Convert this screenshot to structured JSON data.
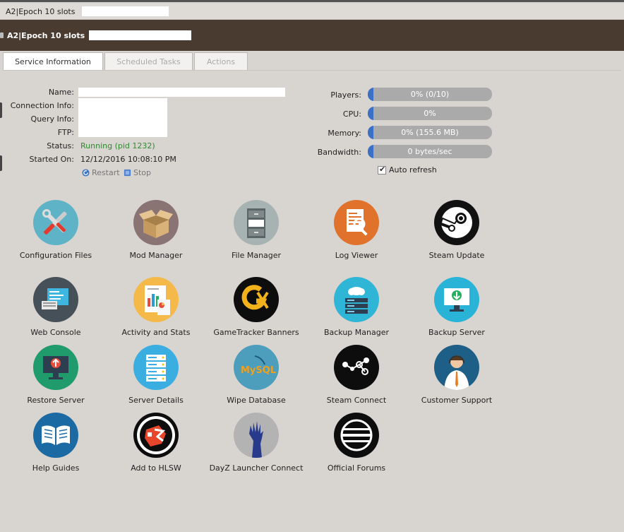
{
  "window": {
    "title": "A2|Epoch 10 slots"
  },
  "header": {
    "title": "A2|Epoch 10 slots"
  },
  "tabs": [
    {
      "label": "Service Information",
      "active": true
    },
    {
      "label": "Scheduled Tasks",
      "active": false
    },
    {
      "label": "Actions",
      "active": false
    }
  ],
  "service": {
    "name_label": "Name:",
    "connection_label": "Connection Info:",
    "query_label": "Query Info:",
    "ftp_label": "FTP:",
    "status_label": "Status:",
    "status_value": "Running (pid 1232)",
    "started_label": "Started On:",
    "started_value": "12/12/2016 10:08:10 PM",
    "restart_label": "Restart",
    "stop_label": "Stop"
  },
  "metrics": {
    "players": {
      "label": "Players:",
      "text": "0% (0/10)",
      "percent": 0
    },
    "cpu": {
      "label": "CPU:",
      "text": "0%",
      "percent": 0
    },
    "memory": {
      "label": "Memory:",
      "text": "0% (155.6 MB)",
      "percent": 0
    },
    "bandwidth": {
      "label": "Bandwidth:",
      "text": "0 bytes/sec",
      "percent": 0
    },
    "auto_refresh_label": "Auto refresh",
    "auto_refresh_checked": true
  },
  "tools": [
    {
      "label": "Configuration Files",
      "icon": "wrench-screwdriver-icon"
    },
    {
      "label": "Mod Manager",
      "icon": "open-box-icon"
    },
    {
      "label": "File Manager",
      "icon": "file-cabinet-icon"
    },
    {
      "label": "Log Viewer",
      "icon": "document-magnifier-icon"
    },
    {
      "label": "Steam Update",
      "icon": "steam-icon"
    },
    {
      "label": "Web Console",
      "icon": "console-icon"
    },
    {
      "label": "Activity and Stats",
      "icon": "stats-report-icon"
    },
    {
      "label": "GameTracker Banners",
      "icon": "gametracker-icon"
    },
    {
      "label": "Backup Manager",
      "icon": "cloud-server-icon"
    },
    {
      "label": "Backup Server",
      "icon": "monitor-download-icon"
    },
    {
      "label": "Restore Server",
      "icon": "monitor-upload-icon"
    },
    {
      "label": "Server Details",
      "icon": "server-rack-icon"
    },
    {
      "label": "Wipe Database",
      "icon": "mysql-icon"
    },
    {
      "label": "Steam Connect",
      "icon": "network-nodes-icon"
    },
    {
      "label": "Customer Support",
      "icon": "support-agent-icon"
    },
    {
      "label": "Help Guides",
      "icon": "open-book-icon"
    },
    {
      "label": "Add to HLSW",
      "icon": "hlsw-icon"
    },
    {
      "label": "DayZ Launcher Connect",
      "icon": "zombie-hand-icon"
    },
    {
      "label": "Official Forums",
      "icon": "forums-logo-icon"
    }
  ],
  "logos": {
    "mysql_text": "MySQL"
  },
  "colors": {
    "header_bg": "#4a3b30",
    "page_bg": "#d8d4d0",
    "status_running": "#2f8a2f",
    "meter_fill": "#3c6fc6",
    "meter_bg": "#aaaaaa"
  }
}
